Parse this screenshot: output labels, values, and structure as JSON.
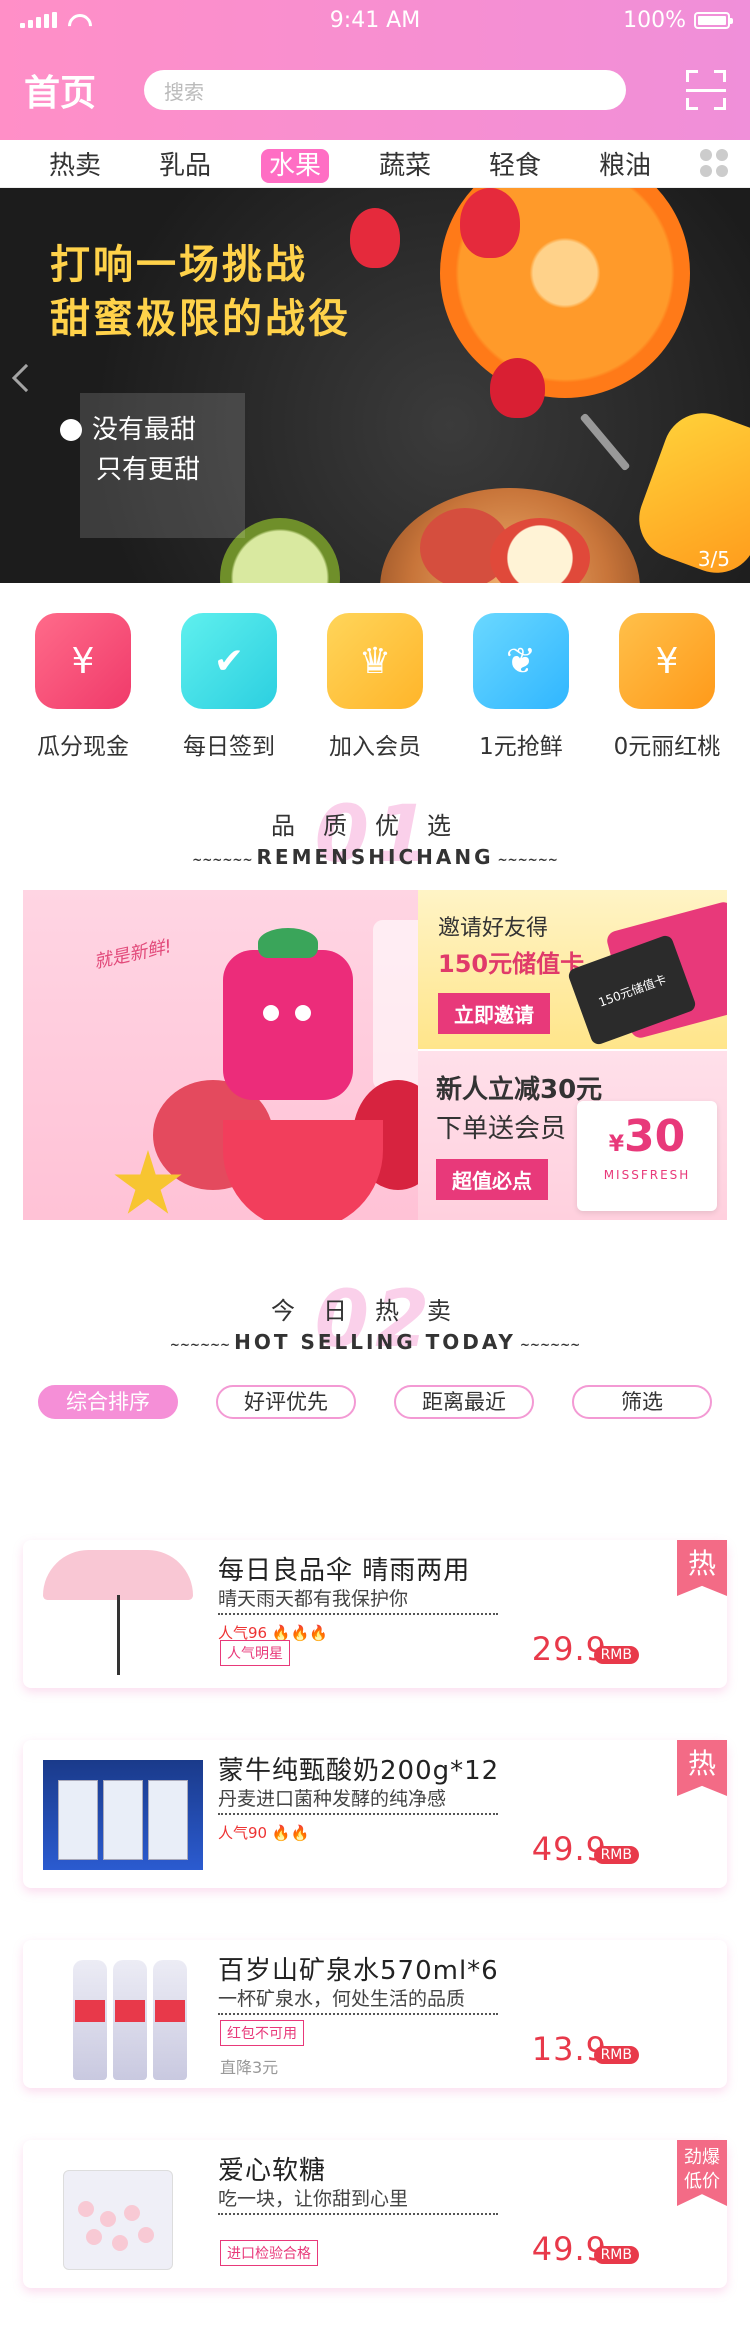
{
  "status": {
    "time": "9:41 AM",
    "battery": "100%"
  },
  "header": {
    "title": "首页",
    "search_placeholder": "搜索"
  },
  "categories": [
    "热卖",
    "乳品",
    "水果",
    "蔬菜",
    "轻食",
    "粮油"
  ],
  "banner": {
    "headline1": "打响一场挑战",
    "headline2": "甜蜜极限的战役",
    "sub1": "没有最甜",
    "sub2": "只有更甜",
    "pager": "3/5"
  },
  "quick": [
    {
      "label": "瓜分现金",
      "icon": "red-envelope-icon",
      "color": "#f7507a",
      "glyph": "¥"
    },
    {
      "label": "每日签到",
      "icon": "calendar-check-icon",
      "color": "#3fe0e8",
      "glyph": "✔"
    },
    {
      "label": "加入会员",
      "icon": "crown-icon",
      "color": "#ffc43d",
      "glyph": "♛"
    },
    {
      "label": "1元抢鲜",
      "icon": "apple-icon",
      "color": "#4cc6ff",
      "glyph": "❦"
    },
    {
      "label": "0元丽红桃",
      "icon": "coin-icon",
      "color": "#ffaa2a",
      "glyph": "¥"
    }
  ],
  "section1": {
    "num": "01",
    "cn": "品质优选",
    "en": "REMENSHICHANG"
  },
  "promo": {
    "tag": "就是新鲜!",
    "invite_title": "邀请好友得",
    "invite_strong": "150元储值卡",
    "invite_btn": "立即邀请",
    "card_text": "150元储值卡",
    "new_title": "新人立减30元",
    "new_sub": "下单送会员",
    "new_btn": "超值必点",
    "coupon_amount": "30",
    "coupon_currency": "¥",
    "coupon_brand": "MISSFRESH"
  },
  "section2": {
    "num": "02",
    "cn": "今日热卖",
    "en": "HOT SELLING TODAY"
  },
  "filters": [
    "综合排序",
    "好评优先",
    "距离最近",
    "筛选"
  ],
  "products": [
    {
      "name": "每日良品伞  晴雨两用",
      "desc": "晴天雨天都有我保护你",
      "popularity": "人气96",
      "flames": "🔥🔥🔥",
      "badge": "人气明星",
      "extra": "",
      "price": "29.9",
      "currency": "RMB",
      "tag": "热"
    },
    {
      "name": "蒙牛纯甄酸奶200g*12",
      "desc": "丹麦进口菌种发酵的纯净感",
      "popularity": "人气90",
      "flames": "🔥🔥",
      "badge": "",
      "extra": "",
      "price": "49.9",
      "currency": "RMB",
      "tag": "热"
    },
    {
      "name": "百岁山矿泉水570ml*6",
      "desc": "一杯矿泉水，何处生活的品质",
      "popularity": "",
      "flames": "",
      "badge": "红包不可用",
      "extra": "直降3元",
      "price": "13.9",
      "currency": "RMB",
      "tag": ""
    },
    {
      "name": "爱心软糖",
      "desc": "吃一块，让你甜到心里",
      "popularity": "",
      "flames": "",
      "badge": "进口检验合格",
      "extra": "",
      "price": "49.9",
      "currency": "RMB",
      "tag": "劲爆低价"
    }
  ]
}
